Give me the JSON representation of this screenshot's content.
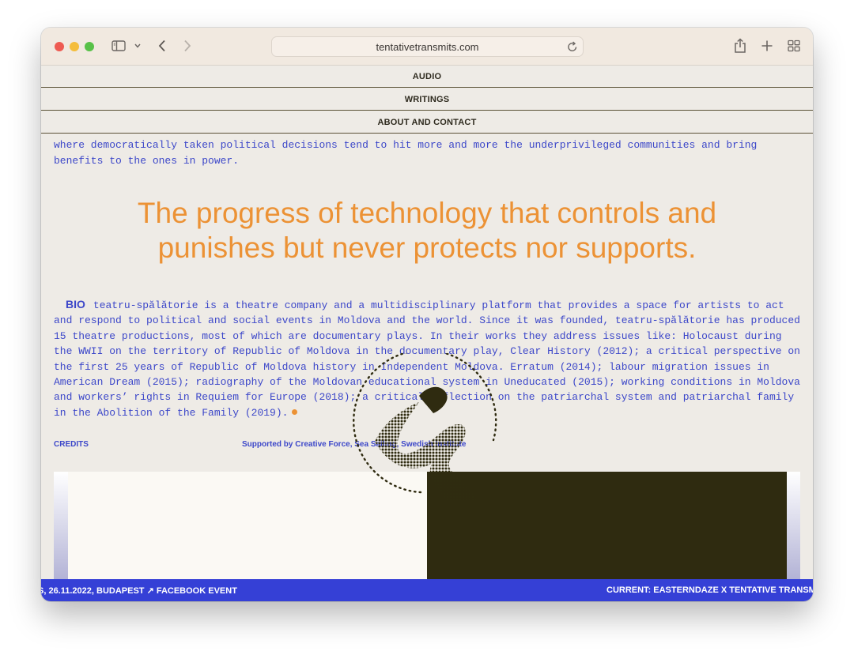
{
  "browser": {
    "url": "tentativetransmits.com",
    "icons": [
      "sidebar-icon",
      "chevron-down-icon",
      "back-icon",
      "forward-icon",
      "reload-icon",
      "share-icon",
      "plus-icon",
      "tabs-grid-icon"
    ]
  },
  "nav": {
    "items": [
      {
        "label": "AUDIO"
      },
      {
        "label": "WRITINGS"
      },
      {
        "label": "ABOUT AND CONTACT"
      }
    ]
  },
  "content": {
    "intro_line1": "where democratically taken political decisions tend to hit more and more the underprivileged communities and bring",
    "intro_line2": "benefits to the ones in power.",
    "headline_line1": "The progress of technology that controls and",
    "headline_line2": "punishes but never protects nor supports.",
    "bio_label": "BIO",
    "bio_text": "teatru-spălătorie is a theatre company and a multidisciplinary platform that provides a space for artists to act and respond to political and social events in Moldova and the world. Since it was founded, teatru-spălătorie has produced 15 theatre productions, most of which are documentary plays. In their works they address issues like: Holocaust during the WWII on the territory of Republic of Moldova in the documentary play, Clear History (2012); a critical perspective on the first 25 years of Republic of Moldova history in Independent Moldova. Erratum (2014); labour migration issues in American Dream (2015); radiography of the Moldovan educational system in Uneducated (2015); working conditions in Moldova and workers’ rights in Requiem for Europe (2018); a critical reflection on the patriarchal system and patriarchal family in the Abolition of the Family (2019).",
    "credits_label": "CREDITS",
    "support_text": "Supported by Creative Force, Sea Sailing, Swedish Institute"
  },
  "ticker": {
    "left_text": "S, 26.11.2022, BUDAPEST ↗ FACEBOOK EVENT",
    "right_text": "CURRENT: EASTERNDAZE X TENTATIVE TRANSMITS"
  },
  "colors": {
    "background": "#eeebe6",
    "text_blue": "#3c47c9",
    "accent_orange": "#ec9235",
    "ticker_blue": "#3540d6",
    "dark_olive": "#2f2b10"
  }
}
